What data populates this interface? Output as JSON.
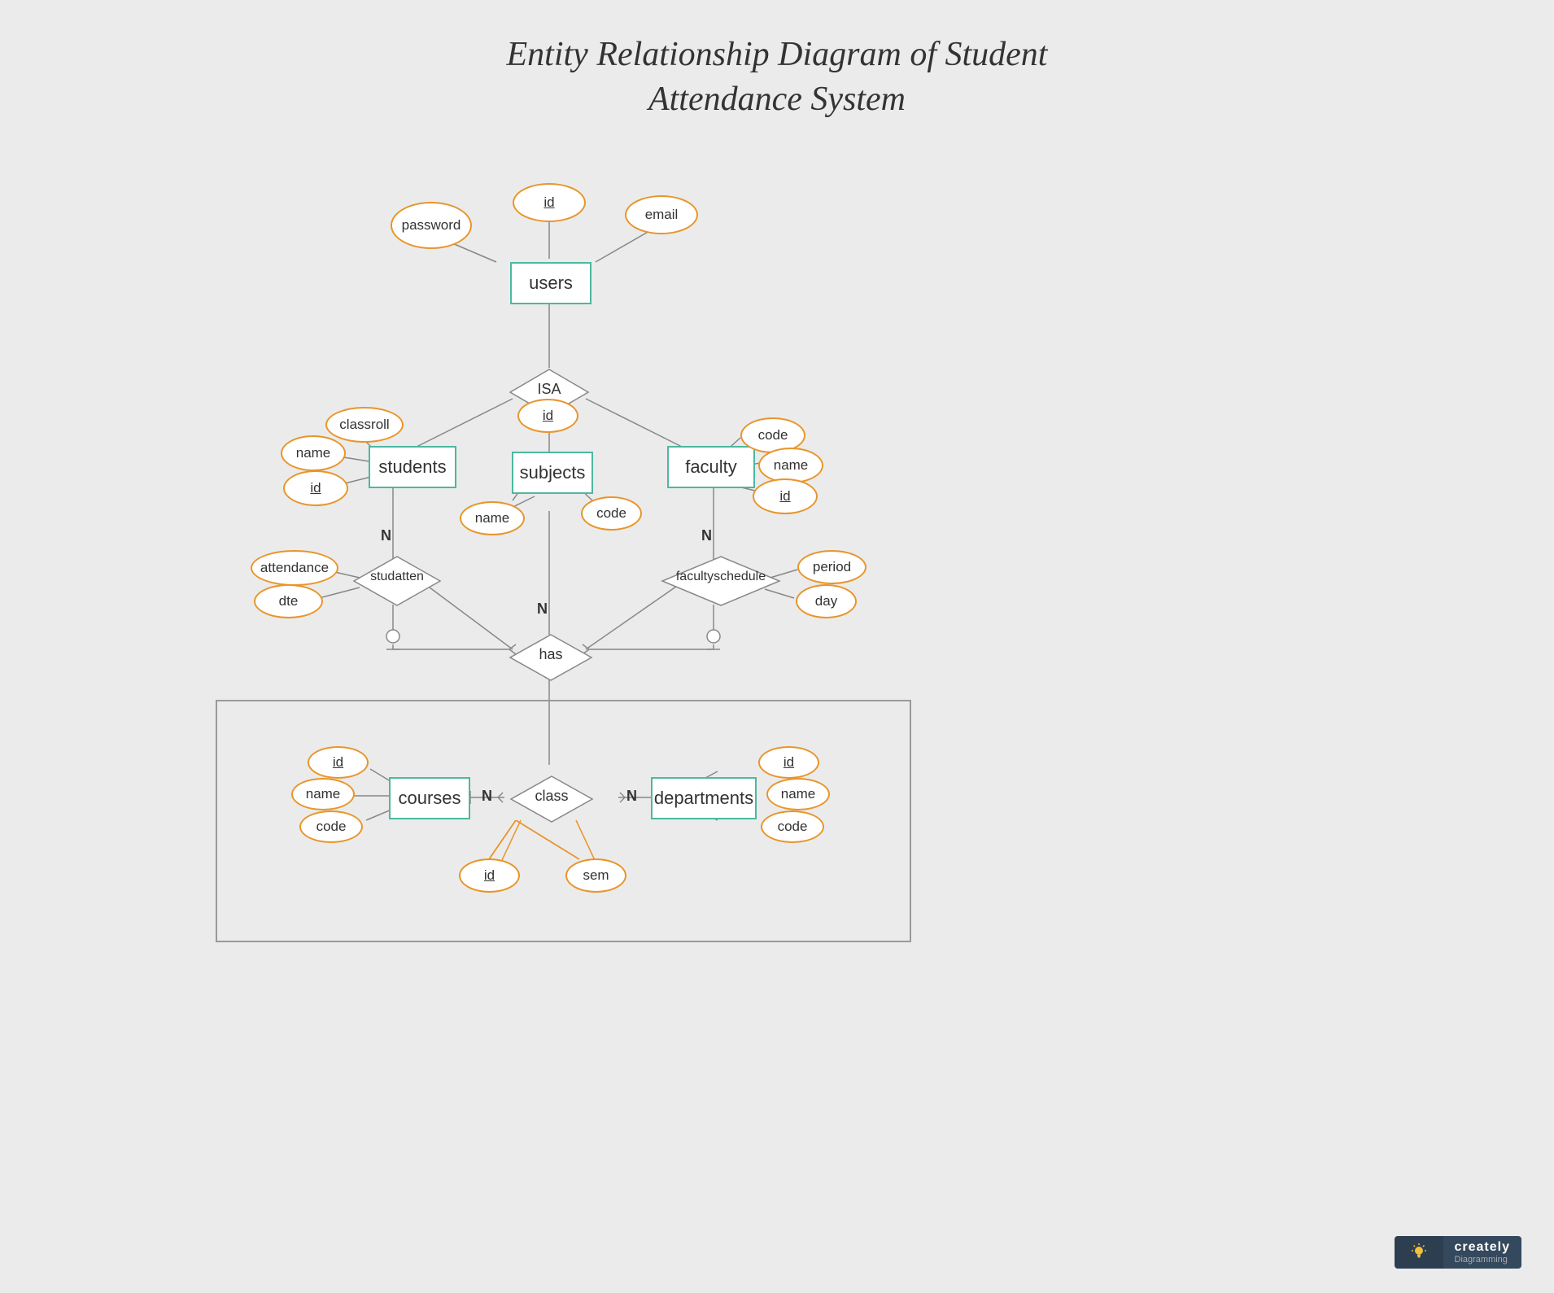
{
  "title": {
    "line1": "Entity Relationship Diagram of Student",
    "line2": "Attendance System"
  },
  "entities": {
    "users": "users",
    "students": "students",
    "faculty": "faculty",
    "subjects": "subjects",
    "courses": "courses",
    "departments": "departments",
    "class": "class"
  },
  "attributes": {
    "users_id": "id",
    "users_password": "password",
    "users_email": "email",
    "students_name": "name",
    "students_classroll": "classroll",
    "students_id": "id",
    "faculty_code": "code",
    "faculty_name": "name",
    "faculty_id": "id",
    "subjects_id": "id",
    "subjects_name": "name",
    "subjects_code": "code",
    "studatten_attendance": "attendance",
    "studatten_dte": "dte",
    "facultyschedule_period": "period",
    "facultyschedule_day": "day",
    "courses_id": "id",
    "courses_name": "name",
    "courses_code": "code",
    "departments_id": "id",
    "departments_name": "name",
    "departments_code": "code",
    "class_id": "id",
    "class_sem": "sem"
  },
  "relationships": {
    "isa": "ISA",
    "studatten": "studatten",
    "facultyschedule": "facultyschedule",
    "has": "has",
    "class_rel": "class"
  },
  "cardinality": {
    "n1": "N",
    "n2": "N",
    "n3": "N",
    "n4": "N"
  },
  "logo": {
    "brand": "creately",
    "sub": "Diagramming"
  }
}
